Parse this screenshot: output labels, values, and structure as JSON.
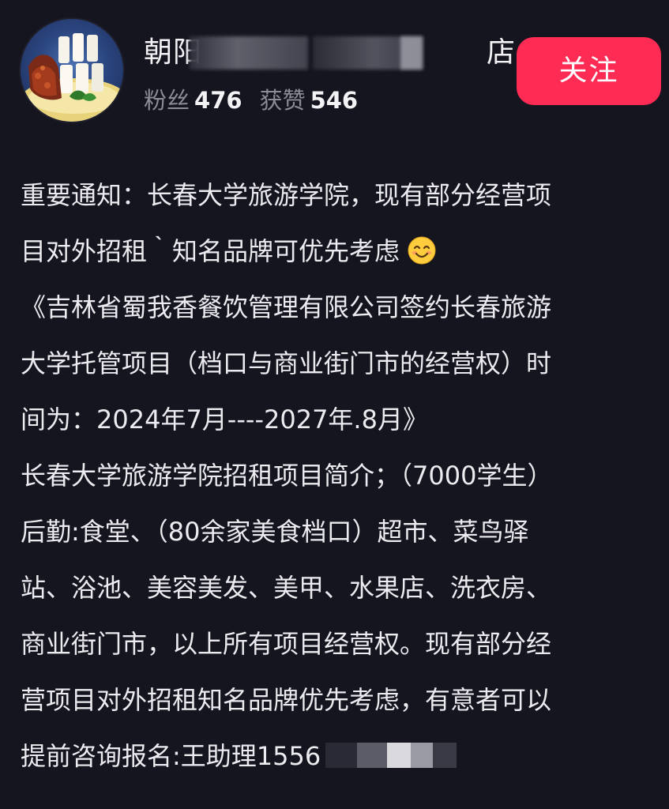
{
  "profile": {
    "name_prefix": "朝阳",
    "name_suffix": "店",
    "stats": [
      {
        "label": "粉丝",
        "value": "476"
      },
      {
        "label": "获赞",
        "value": "546"
      }
    ],
    "follow_label": "关注"
  },
  "description": {
    "lines": [
      "重要通知：长春大学旅游学院，现有部分经营项",
      "目对外招租｀知名品牌可优先考虑",
      "《吉林省蜀我香餐饮管理有限公司签约长春旅游",
      "大学托管项目（档口与商业街门市的经营权）时",
      "间为：2024年7月----2027年.8月》",
      "长春大学旅游学院招租项目简介；（7000学生）",
      "后勤:食堂、（80余家美食档口）超市、菜鸟驿",
      "站、浴池、美容美发、美甲、水果店、洗衣房、",
      "商业街门市，以上所有项目经营权。现有部分经",
      "营项目对外招租知名品牌优先考虑，有意者可以",
      "提前咨询报名:王助理1556"
    ],
    "emoji": "smiling-face-icon"
  },
  "colors": {
    "background": "#15151f",
    "follow_button": "#fe2c55",
    "muted_text": "#8c8c98"
  }
}
